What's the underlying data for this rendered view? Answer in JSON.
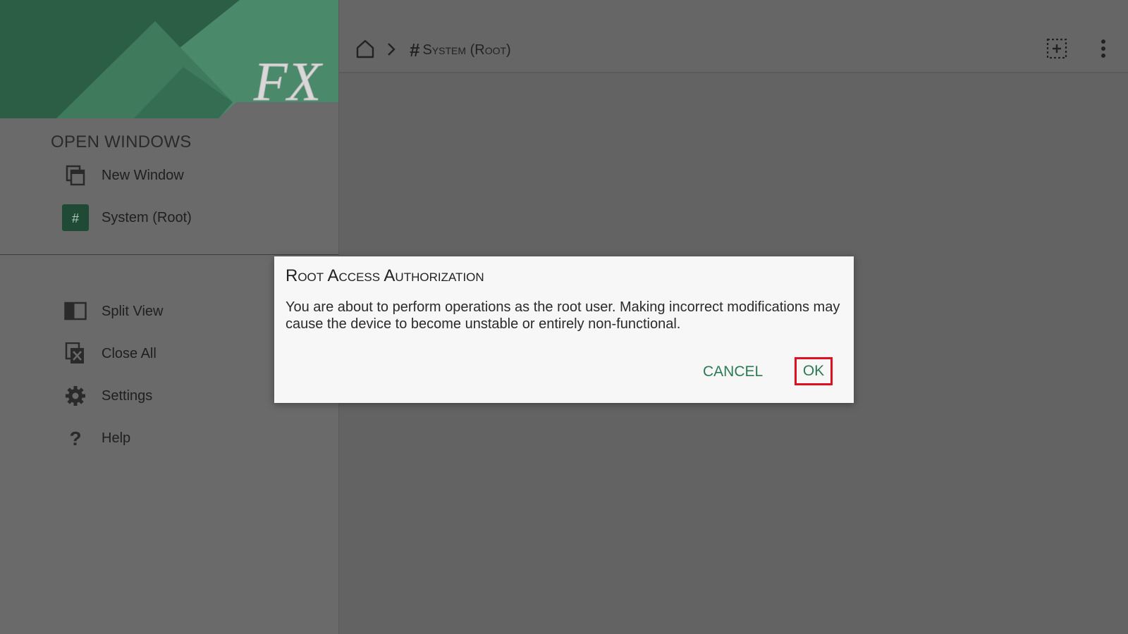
{
  "sidebar": {
    "section_title": "OPEN WINDOWS",
    "open_windows": [
      {
        "label": "New Window",
        "icon": "new-window-icon"
      },
      {
        "label": "System (Root)",
        "icon": "hash-icon"
      }
    ],
    "actions": [
      {
        "label": "Split View",
        "icon": "split-view-icon"
      },
      {
        "label": "Close All",
        "icon": "close-all-icon"
      },
      {
        "label": "Settings",
        "icon": "gear-icon"
      },
      {
        "label": "Help",
        "icon": "help-icon"
      }
    ],
    "logo_text": "FX"
  },
  "toolbar": {
    "breadcrumb_prefix": "#",
    "breadcrumb_label": "System (Root)",
    "icons": [
      "home-icon",
      "chevron-right-icon",
      "select-add-icon",
      "more-vert-icon"
    ]
  },
  "dialog": {
    "title": "Root Access Authorization",
    "message": "You are about to perform operations as the root user. Making incorrect modifications may cause the device to become unstable or entirely non-functional.",
    "cancel_label": "CANCEL",
    "ok_label": "OK"
  },
  "colors": {
    "accent": "#2b7a55",
    "banner_green": "#2e6b4f",
    "highlight": "#e01020"
  }
}
